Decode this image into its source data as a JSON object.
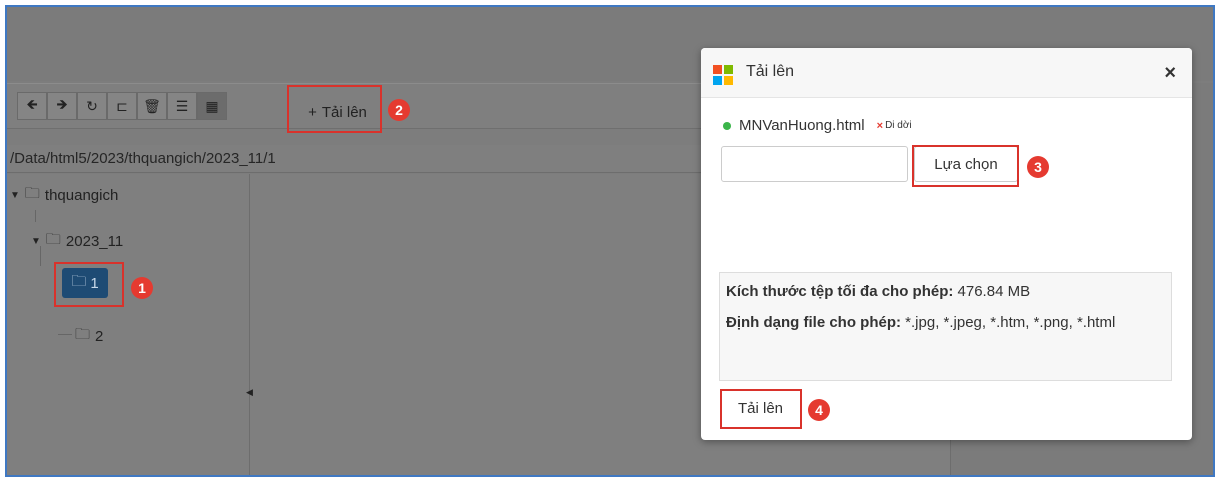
{
  "toolbar": {
    "buttons": [
      {
        "icon": "undo-icon",
        "glyph": "🡸"
      },
      {
        "icon": "redo-icon",
        "glyph": "🡺"
      },
      {
        "icon": "refresh-icon",
        "glyph": "↻"
      },
      {
        "icon": "new-folder-icon",
        "glyph": "⊏"
      },
      {
        "icon": "trash-icon",
        "glyph": "🗑"
      },
      {
        "icon": "list-view-icon",
        "glyph": "☰"
      },
      {
        "icon": "grid-view-icon",
        "glyph": "▦"
      }
    ],
    "upload_label": "Tải lên",
    "upload_glyph": "+"
  },
  "path": "/Data/html5/2023/thquangich/2023_11/1",
  "tree": {
    "root": "thquangich",
    "child": "2023_11",
    "selected": "1",
    "sibling": "2"
  },
  "callouts": [
    "1",
    "2",
    "3",
    "4"
  ],
  "modal": {
    "title": "Tải lên",
    "close_glyph": "×",
    "file_name": "MNVanHuong.html",
    "remove_label": "Di dời",
    "remove_glyph": "×",
    "file_input_value": "",
    "choose_label": "Lựa chọn",
    "max_size_label": "Kích thước tệp tối đa cho phép:",
    "max_size_value": "476.84 MB",
    "formats_label": "Định dạng file cho phép:",
    "formats_value": "*.jpg, *.jpeg, *.htm, *.png, *.html",
    "submit_label": "Tải lên"
  },
  "colors": {
    "callout_red": "#e53a30",
    "frame_blue": "#3f78c2",
    "selected_node": "#1e4b74",
    "file_ok_green": "#3bb54a",
    "logo": [
      "#f25022",
      "#7fba00",
      "#00a4ef",
      "#ffb900"
    ]
  }
}
